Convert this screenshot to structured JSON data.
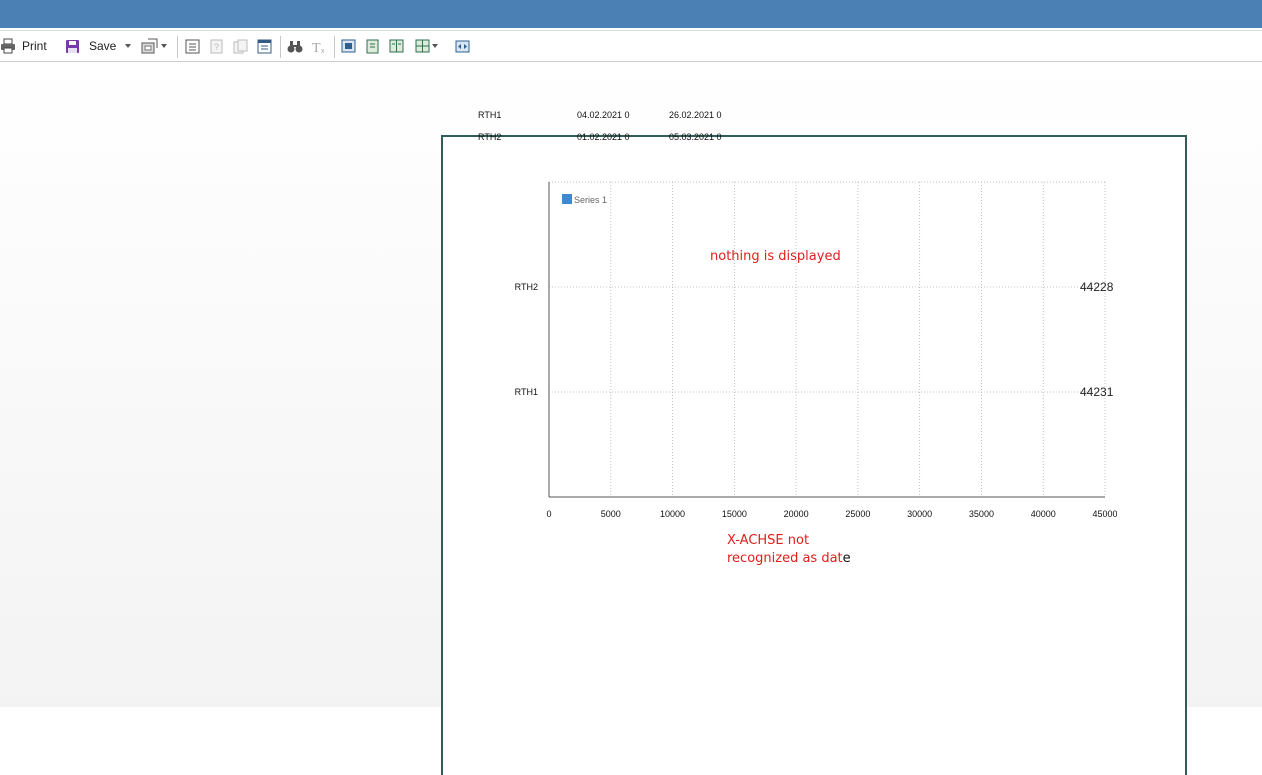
{
  "toolbar": {
    "print_label": "Print",
    "save_label": "Save",
    "icons": [
      "printer-icon",
      "save-disk-icon",
      "export-icon",
      "document-map-icon",
      "parameters-icon",
      "copy-icon",
      "page-setup-icon",
      "find-icon",
      "text-format-icon",
      "single-page-icon",
      "page-view-icon",
      "two-pages-icon",
      "multi-page-icon",
      "fit-width-icon"
    ]
  },
  "report": {
    "rows": [
      {
        "name": "RTH1",
        "start": "04.02.2021 0",
        "end": "26.02.2021 0"
      },
      {
        "name": "RTH2",
        "start": "01.02.2021 0",
        "end": "05.03.2021 0"
      }
    ]
  },
  "chart_data": {
    "type": "bar",
    "orientation": "horizontal",
    "categories": [
      "RTH1",
      "RTH2"
    ],
    "series": [
      {
        "name": "Series 1",
        "values": [
          44231,
          44228
        ]
      }
    ],
    "data_labels": [
      "44231",
      "44228"
    ],
    "xlim": [
      0,
      45000
    ],
    "xticks": [
      0,
      5000,
      10000,
      15000,
      20000,
      25000,
      30000,
      35000,
      40000,
      45000
    ],
    "xtick_labels": [
      "0",
      "5000",
      "10000",
      "15000",
      "20000",
      "25000",
      "30000",
      "35000",
      "40000",
      "45000"
    ],
    "grid": true,
    "legend": "top-left",
    "colors": {
      "series": "#3a8ad6",
      "grid": "#b0b0b0"
    }
  },
  "annotations": {
    "nothing_displayed": "nothing is displayed",
    "xaxis_note_line1": "X-ACHSE not",
    "xaxis_note_line2": "recognized as dat",
    "xaxis_note_tail": "e"
  }
}
